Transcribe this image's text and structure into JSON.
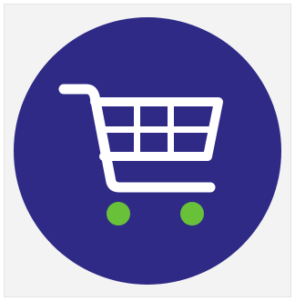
{
  "icon": {
    "name": "shopping-cart-icon",
    "colors": {
      "circle": "#2e2a86",
      "cart": "#ffffff",
      "wheels": "#69c13a",
      "background": "#f3f3f3"
    }
  }
}
